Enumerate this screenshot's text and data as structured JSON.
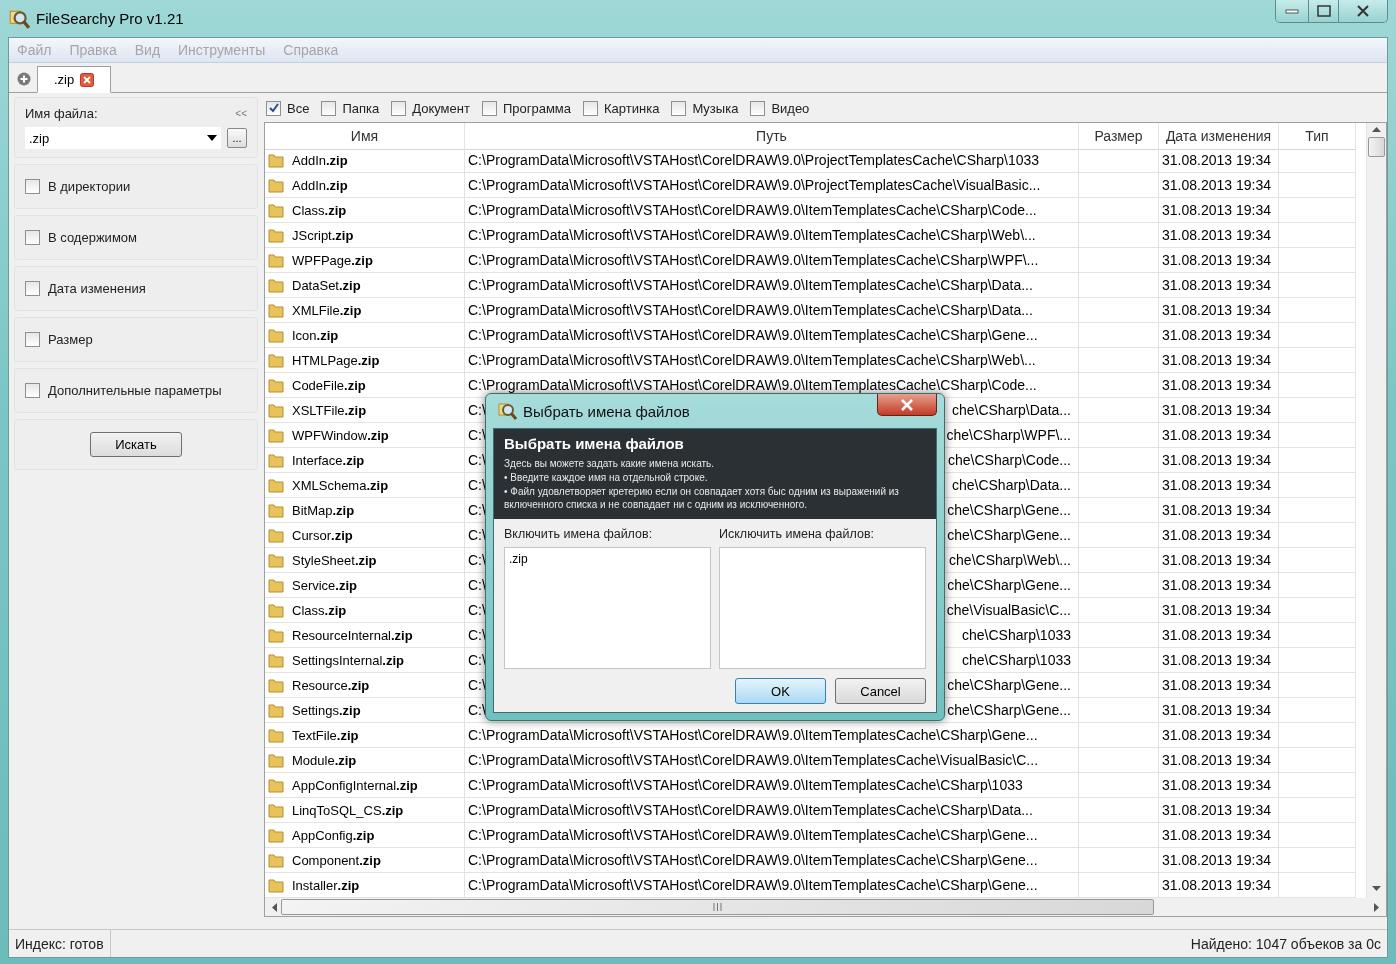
{
  "window": {
    "title": "FileSearchy Pro v1.21"
  },
  "menu": [
    {
      "label": "Файл",
      "disabled": true
    },
    {
      "label": "Правка",
      "disabled": true
    },
    {
      "label": "Вид",
      "disabled": true
    },
    {
      "label": "Инструменты",
      "disabled": true
    },
    {
      "label": "Справка",
      "disabled": true
    }
  ],
  "tabs": [
    {
      "label": ".zip",
      "selected": true
    }
  ],
  "sidebar": {
    "filename_label": "Имя файла:",
    "collapse": "<<",
    "filename_value": ".zip",
    "browse_button": "...",
    "sections": [
      {
        "label": "В директории",
        "checked": false
      },
      {
        "label": "В содержимом",
        "checked": false
      },
      {
        "label": "Дата изменения",
        "checked": false
      },
      {
        "label": "Размер",
        "checked": false
      },
      {
        "label": "Дополнительные параметры",
        "checked": false
      }
    ],
    "search_button": "Искать"
  },
  "filters": [
    {
      "label": "Все",
      "checked": true
    },
    {
      "label": "Папка",
      "checked": false
    },
    {
      "label": "Документ",
      "checked": false
    },
    {
      "label": "Программа",
      "checked": false
    },
    {
      "label": "Картинка",
      "checked": false
    },
    {
      "label": "Музыка",
      "checked": false
    },
    {
      "label": "Видео",
      "checked": false
    }
  ],
  "table": {
    "columns": [
      "Имя",
      "Путь",
      "Размер",
      "Дата изменения",
      "Тип"
    ],
    "rows": [
      {
        "name": "AddIn**.zip**",
        "path": "C:\\ProgramData\\Microsoft\\VSTAHost\\CorelDRAW\\9.0\\ProjectTemplatesCache\\CSharp\\1033",
        "date": "31.08.2013 19:34"
      },
      {
        "name": "AddIn**.zip**",
        "path": "C:\\ProgramData\\Microsoft\\VSTAHost\\CorelDRAW\\9.0\\ProjectTemplatesCache\\VisualBasic...",
        "date": "31.08.2013 19:34"
      },
      {
        "name": "Class**.zip**",
        "path": "C:\\ProgramData\\Microsoft\\VSTAHost\\CorelDRAW\\9.0\\ItemTemplatesCache\\CSharp\\Code...",
        "date": "31.08.2013 19:34"
      },
      {
        "name": "JScript**.zip**",
        "path": "C:\\ProgramData\\Microsoft\\VSTAHost\\CorelDRAW\\9.0\\ItemTemplatesCache\\CSharp\\Web\\...",
        "date": "31.08.2013 19:34"
      },
      {
        "name": "WPFPage**.zip**",
        "path": "C:\\ProgramData\\Microsoft\\VSTAHost\\CorelDRAW\\9.0\\ItemTemplatesCache\\CSharp\\WPF\\...",
        "date": "31.08.2013 19:34"
      },
      {
        "name": "DataSet**.zip**",
        "path": "C:\\ProgramData\\Microsoft\\VSTAHost\\CorelDRAW\\9.0\\ItemTemplatesCache\\CSharp\\Data...",
        "date": "31.08.2013 19:34"
      },
      {
        "name": "XMLFile**.zip**",
        "path": "C:\\ProgramData\\Microsoft\\VSTAHost\\CorelDRAW\\9.0\\ItemTemplatesCache\\CSharp\\Data...",
        "date": "31.08.2013 19:34"
      },
      {
        "name": "Icon**.zip**",
        "path": "C:\\ProgramData\\Microsoft\\VSTAHost\\CorelDRAW\\9.0\\ItemTemplatesCache\\CSharp\\Gene...",
        "date": "31.08.2013 19:34"
      },
      {
        "name": "HTMLPage**.zip**",
        "path": "C:\\ProgramData\\Microsoft\\VSTAHost\\CorelDRAW\\9.0\\ItemTemplatesCache\\CSharp\\Web\\...",
        "date": "31.08.2013 19:34"
      },
      {
        "name": "CodeFile**.zip**",
        "path": "C:\\ProgramData\\Microsoft\\VSTAHost\\CorelDRAW\\9.0\\ItemTemplatesCache\\CSharp\\Code...",
        "date": "31.08.2013 19:34"
      },
      {
        "name": "XSLTFile**.zip**",
        "path_start": "C:\\",
        "path_end": "che\\CSharp\\Data...",
        "date": "31.08.2013 19:34"
      },
      {
        "name": "WPFWindow**.zip**",
        "path_start": "C:\\",
        "path_end": "che\\CSharp\\WPF\\...",
        "date": "31.08.2013 19:34"
      },
      {
        "name": "Interface**.zip**",
        "path_start": "C:\\",
        "path_end": "che\\CSharp\\Code...",
        "date": "31.08.2013 19:34"
      },
      {
        "name": "XMLSchema**.zip**",
        "path_start": "C:\\",
        "path_end": "che\\CSharp\\Data...",
        "date": "31.08.2013 19:34"
      },
      {
        "name": "BitMap**.zip**",
        "path_start": "C:\\",
        "path_end": "che\\CSharp\\Gene...",
        "date": "31.08.2013 19:34"
      },
      {
        "name": "Cursor**.zip**",
        "path_start": "C:\\",
        "path_end": "che\\CSharp\\Gene...",
        "date": "31.08.2013 19:34"
      },
      {
        "name": "StyleSheet**.zip**",
        "path_start": "C:\\",
        "path_end": "che\\CSharp\\Web\\...",
        "date": "31.08.2013 19:34"
      },
      {
        "name": "Service**.zip**",
        "path_start": "C:\\",
        "path_end": "che\\CSharp\\Gene...",
        "date": "31.08.2013 19:34"
      },
      {
        "name": "Class**.zip**",
        "path_start": "C:\\",
        "path_end": "che\\VisualBasic\\C...",
        "date": "31.08.2013 19:34"
      },
      {
        "name": "ResourceInternal**.zip**",
        "path_start": "C:\\",
        "path_end": "che\\CSharp\\1033",
        "date": "31.08.2013 19:34"
      },
      {
        "name": "SettingsInternal**.zip**",
        "path_start": "C:\\",
        "path_end": "che\\CSharp\\1033",
        "date": "31.08.2013 19:34"
      },
      {
        "name": "Resource**.zip**",
        "path_start": "C:\\",
        "path_end": "che\\CSharp\\Gene...",
        "date": "31.08.2013 19:34"
      },
      {
        "name": "Settings**.zip**",
        "path_start": "C:\\",
        "path_end": "che\\CSharp\\Gene...",
        "date": "31.08.2013 19:34"
      },
      {
        "name": "TextFile**.zip**",
        "path": "C:\\ProgramData\\Microsoft\\VSTAHost\\CorelDRAW\\9.0\\ItemTemplatesCache\\CSharp\\Gene...",
        "date": "31.08.2013 19:34"
      },
      {
        "name": "Module**.zip**",
        "path": "C:\\ProgramData\\Microsoft\\VSTAHost\\CorelDRAW\\9.0\\ItemTemplatesCache\\VisualBasic\\C...",
        "date": "31.08.2013 19:34"
      },
      {
        "name": "AppConfigInternal**.zip**",
        "path": "C:\\ProgramData\\Microsoft\\VSTAHost\\CorelDRAW\\9.0\\ItemTemplatesCache\\CSharp\\1033",
        "date": "31.08.2013 19:34"
      },
      {
        "name": "LinqToSQL_CS**.zip**",
        "path": "C:\\ProgramData\\Microsoft\\VSTAHost\\CorelDRAW\\9.0\\ItemTemplatesCache\\CSharp\\Data...",
        "date": "31.08.2013 19:34"
      },
      {
        "name": "AppConfig**.zip**",
        "path": "C:\\ProgramData\\Microsoft\\VSTAHost\\CorelDRAW\\9.0\\ItemTemplatesCache\\CSharp\\Gene...",
        "date": "31.08.2013 19:34"
      },
      {
        "name": "Component**.zip**",
        "path": "C:\\ProgramData\\Microsoft\\VSTAHost\\CorelDRAW\\9.0\\ItemTemplatesCache\\CSharp\\Gene...",
        "date": "31.08.2013 19:34"
      },
      {
        "name": "Installer**.zip**",
        "path": "C:\\ProgramData\\Microsoft\\VSTAHost\\CorelDRAW\\9.0\\ItemTemplatesCache\\CSharp\\Gene...",
        "date": "31.08.2013 19:34"
      }
    ]
  },
  "status_bar": {
    "left": "Индекс: готов",
    "right": "Найдено: 1047 объеков за 0с"
  },
  "dialog": {
    "title": "Выбрать имена файлов",
    "heading": "Выбрать имена файлов",
    "description": [
      "Здесь вы можете задать какие имена искать.",
      "• Введите каждое имя на отдельной строке.",
      "• Файл удовлетворяет кретерию если он совпадает хотя быс одним из выражений из включенного списка и не совпадает ни с одним из исключенного."
    ],
    "include_label": "Включить имена файлов:",
    "include_value": ".zip",
    "exclude_label": "Исключить имена файлов:",
    "buttons": [
      {
        "label": "OK",
        "selected": true
      },
      {
        "label": "Cancel",
        "selected": false
      }
    ]
  }
}
